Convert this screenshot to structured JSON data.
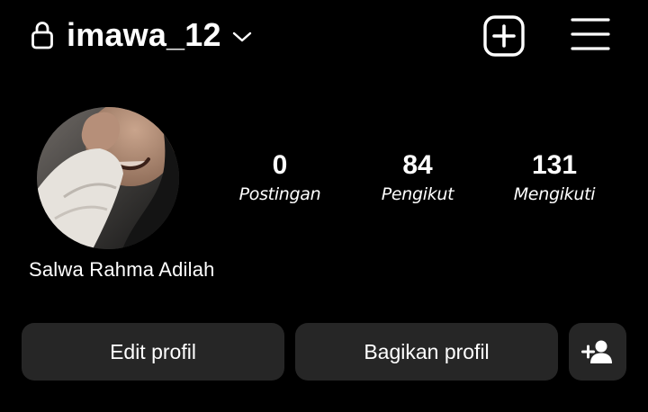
{
  "header": {
    "username": "imawa_12",
    "icons": {
      "lock": "lock-icon",
      "switcher": "chevron-down-icon",
      "create": "plus-square-icon",
      "menu": "hamburger-menu-icon"
    }
  },
  "profile": {
    "display_name": "Salwa Rahma Adilah",
    "avatar": "profile-photo",
    "stats": [
      {
        "count": "0",
        "label": "Postingan"
      },
      {
        "count": "84",
        "label": "Pengikut"
      },
      {
        "count": "131",
        "label": "Mengikuti"
      }
    ]
  },
  "actions": {
    "edit_label": "Edit profil",
    "share_label": "Bagikan profil",
    "suggest_icon": "person-add-icon"
  },
  "colors": {
    "background": "#000000",
    "text": "#ffffff",
    "button": "#262626"
  }
}
